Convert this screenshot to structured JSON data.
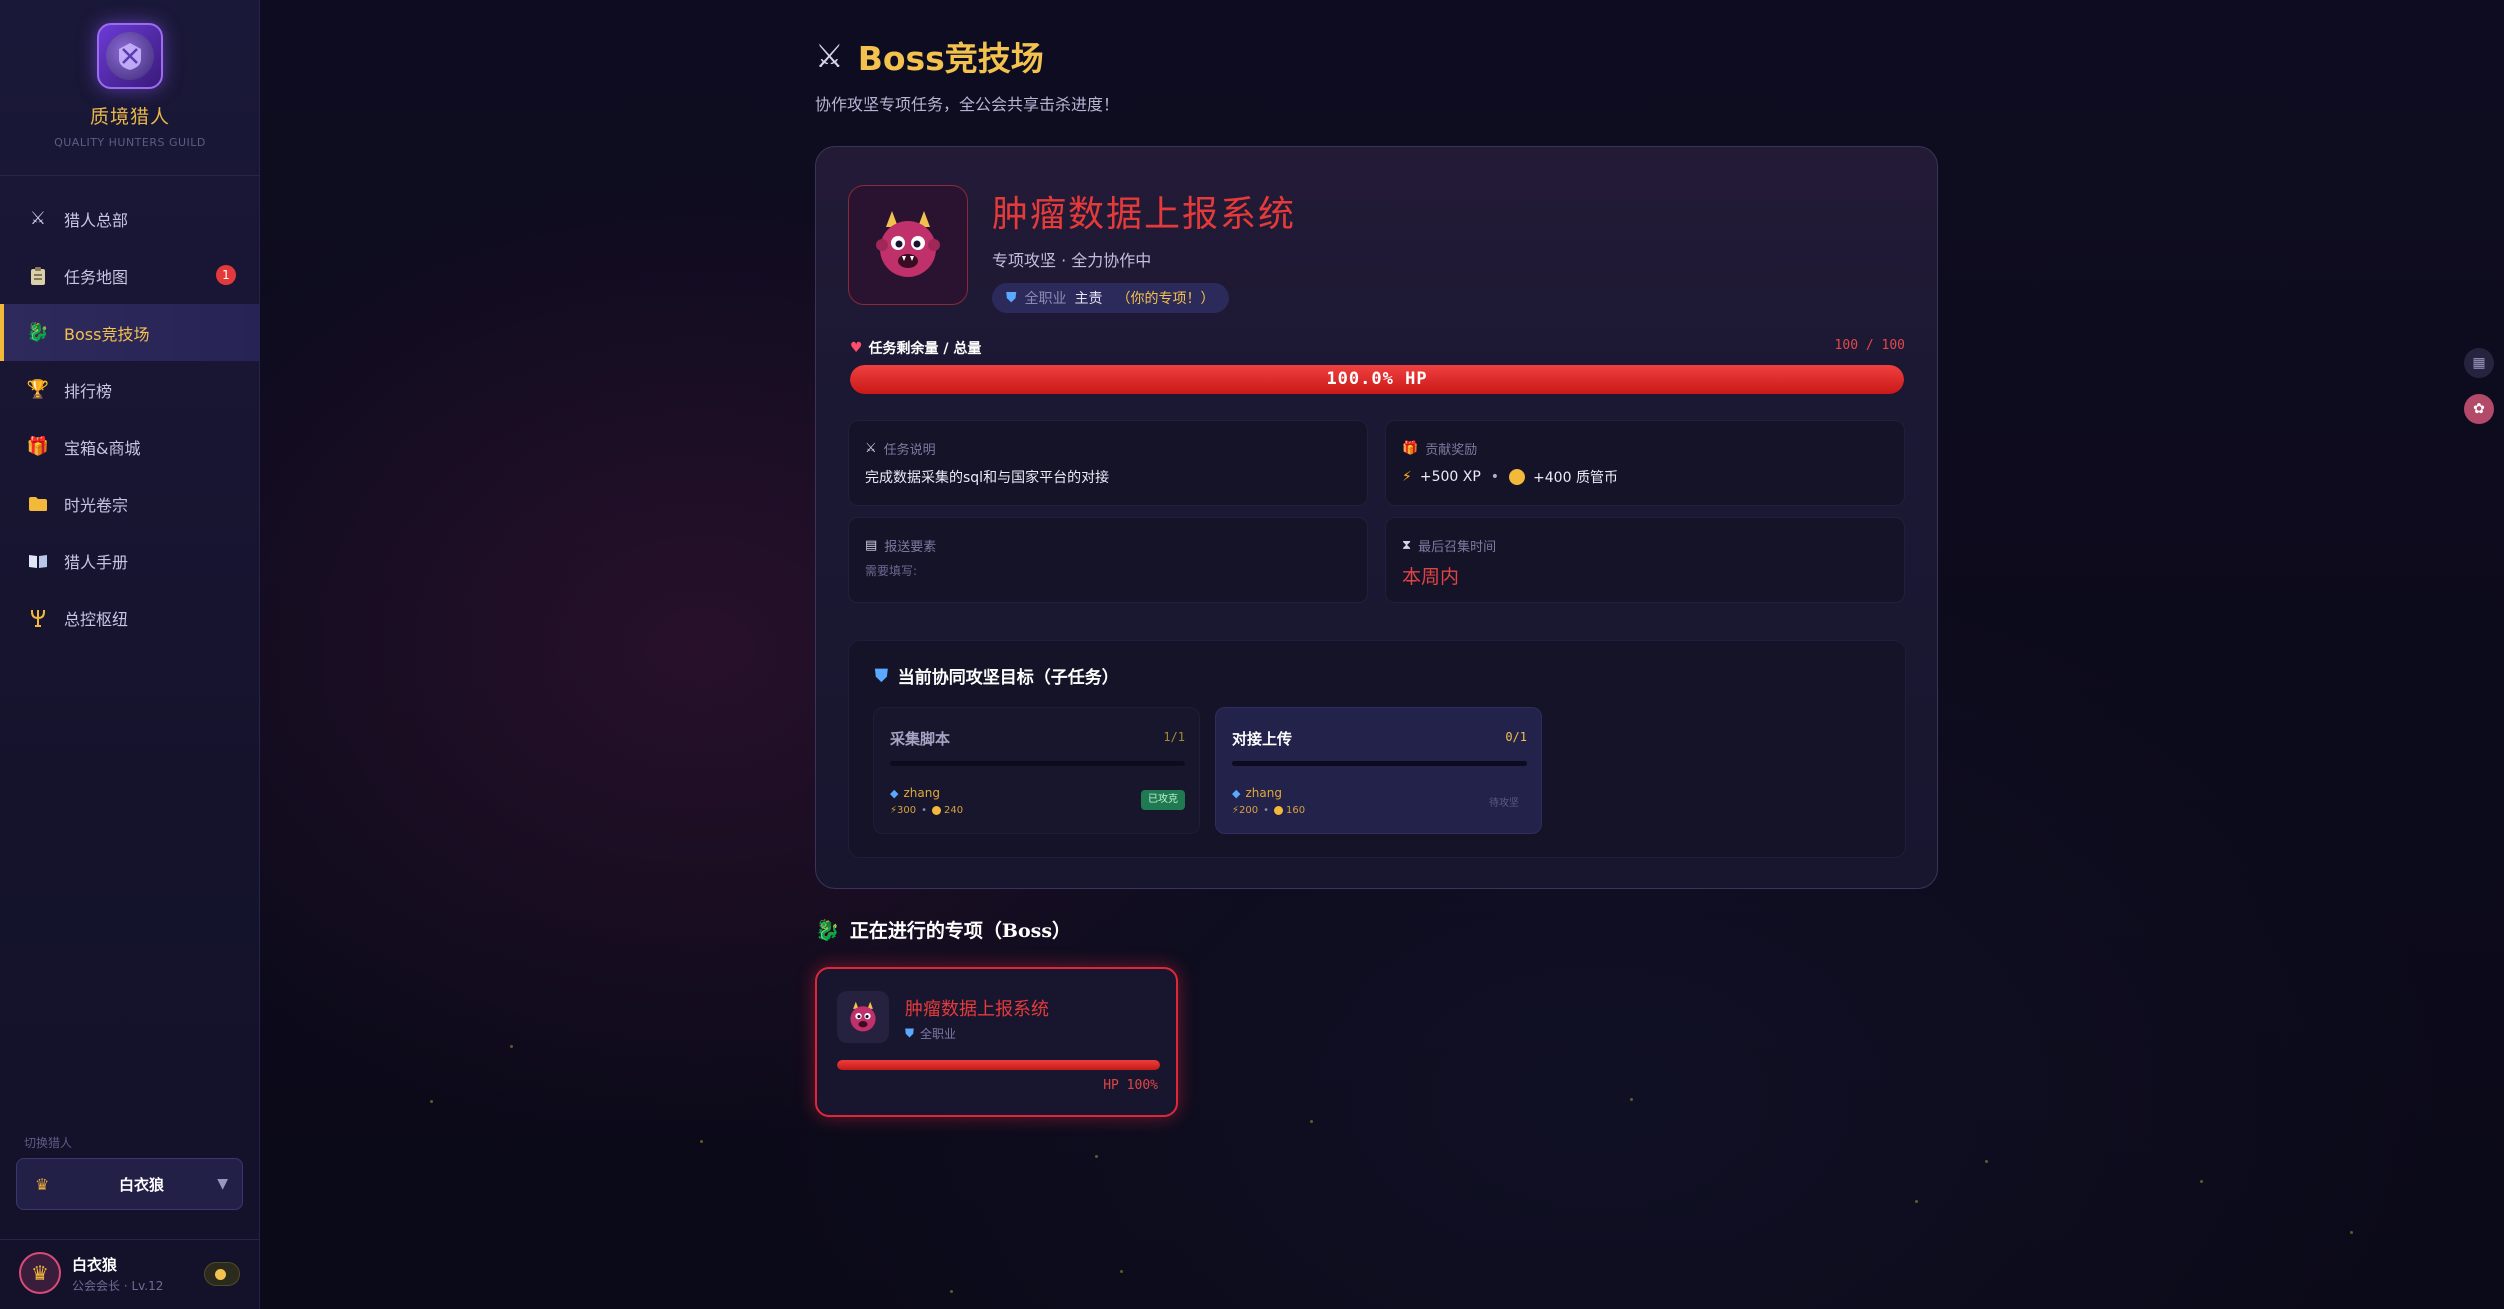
{
  "sidebar": {
    "guild_name": "质境猎人",
    "guild_sub": "QUALITY HUNTERS GUILD",
    "items": [
      {
        "label": "猎人总部",
        "icon": "crossed-swords-icon"
      },
      {
        "label": "任务地图",
        "icon": "clipboard-icon",
        "badge": "1"
      },
      {
        "label": "Boss竞技场",
        "icon": "dragon-icon",
        "active": true
      },
      {
        "label": "排行榜",
        "icon": "trophy-icon"
      },
      {
        "label": "宝箱&商城",
        "icon": "gift-icon"
      },
      {
        "label": "时光卷宗",
        "icon": "folder-icon"
      },
      {
        "label": "猎人手册",
        "icon": "book-icon"
      },
      {
        "label": "总控枢纽",
        "icon": "trident-icon"
      }
    ],
    "switch_label": "切换猎人",
    "switch_value": "白衣狼",
    "user": {
      "name": "白衣狼",
      "role": "公会会长 · Lv.12"
    }
  },
  "header": {
    "title": "Boss竞技场",
    "subtitle": "协作攻坚专项任务，全公会共享击杀进度！"
  },
  "boss": {
    "name": "肿瘤数据上报系统",
    "meta": "专项攻坚 · 全力协作中",
    "class_label": "全职业",
    "owner_label": "主责",
    "yours": "（你的专项！）",
    "hp_label": "任务剩余量 / 总量",
    "hp_count": "100 / 100",
    "hp_text": "100.0% HP",
    "hp_fraction": 1.0,
    "info": {
      "desc_label": "任务说明",
      "desc_value": "完成数据采集的sql和与国家平台的对接",
      "reward_label": "贡献奖励",
      "reward_xp": "+500 XP",
      "reward_coin": "+400 质管币",
      "report_label": "报送要素",
      "report_value": "需要填写:",
      "deadline_label": "最后召集时间",
      "deadline_value": "本周内"
    },
    "subtasks_title": "当前协同攻坚目标（子任务）",
    "subtasks": [
      {
        "name": "采集脚本",
        "count": "1/1",
        "owner": "zhang",
        "xp": "300",
        "coin": "240",
        "status": "已攻克"
      },
      {
        "name": "对接上传",
        "count": "0/1",
        "owner": "zhang",
        "xp": "200",
        "coin": "160",
        "status": "待攻坚"
      }
    ]
  },
  "ongoing": {
    "title": "正在进行的专项（Boss）",
    "cards": [
      {
        "name": "肿瘤数据上报系统",
        "class_label": "全职业",
        "hp_text": "HP 100%",
        "hp_fraction": 1.0
      }
    ]
  },
  "colors": {
    "accent": "#f2c14e",
    "boss_red": "#e53a3a",
    "bg": "#0d0b1c"
  }
}
